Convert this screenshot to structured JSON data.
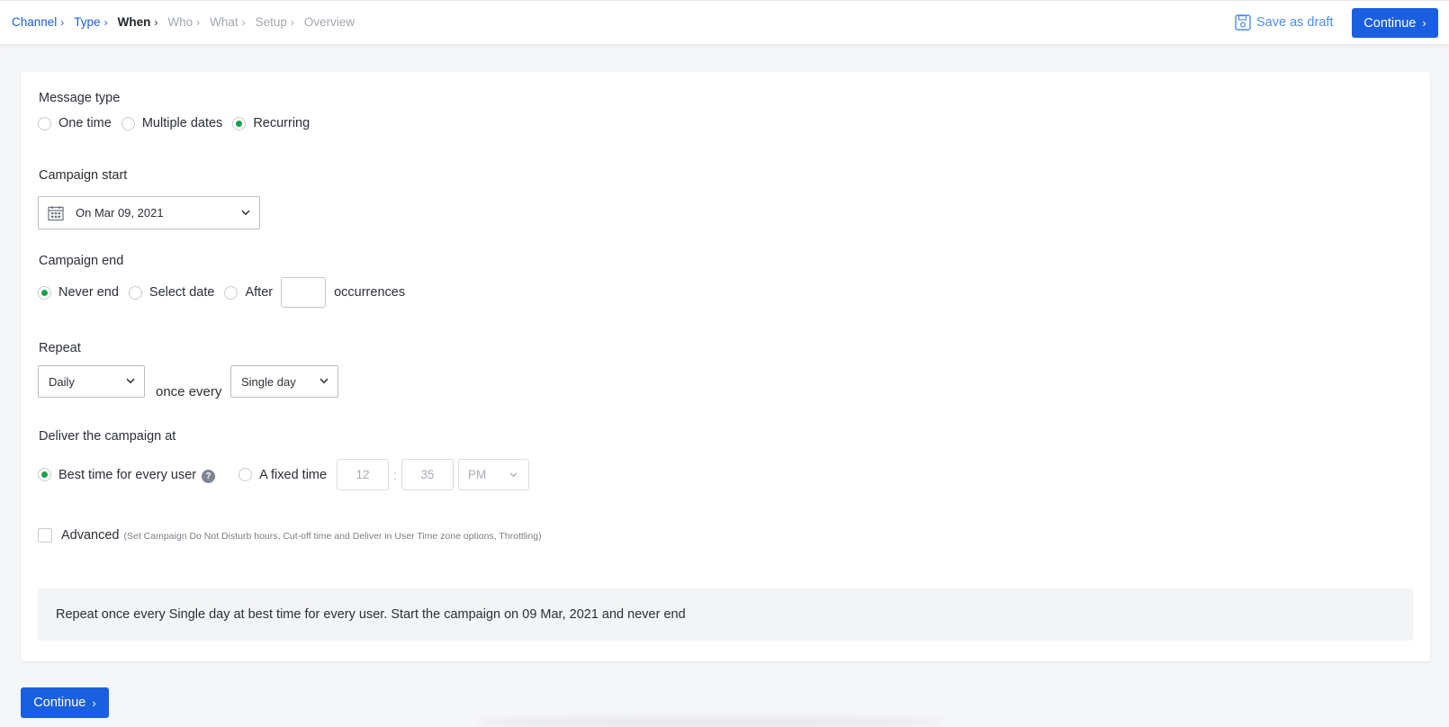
{
  "breadcrumb": [
    {
      "label": "Channel",
      "state": "done"
    },
    {
      "label": "Type",
      "state": "done"
    },
    {
      "label": "When",
      "state": "active"
    },
    {
      "label": "Who",
      "state": "todo"
    },
    {
      "label": "What",
      "state": "todo"
    },
    {
      "label": "Setup",
      "state": "todo"
    },
    {
      "label": "Overview",
      "state": "todo"
    }
  ],
  "header": {
    "save_draft_label": "Save as draft",
    "continue_label": "Continue"
  },
  "message_type": {
    "label": "Message type",
    "options": [
      "One time",
      "Multiple dates",
      "Recurring"
    ],
    "selected": "Recurring"
  },
  "campaign_start": {
    "label": "Campaign start",
    "value": "On Mar 09, 2021"
  },
  "campaign_end": {
    "label": "Campaign end",
    "options": [
      "Never end",
      "Select date",
      "After"
    ],
    "selected": "Never end",
    "occurrences_value": "",
    "occurrences_suffix": "occurrences"
  },
  "repeat": {
    "label": "Repeat",
    "frequency": "Daily",
    "connector": "once every",
    "interval": "Single day"
  },
  "deliver": {
    "label": "Deliver the campaign at",
    "options": [
      "Best time for every user",
      "A fixed time"
    ],
    "selected": "Best time for every user",
    "hour_placeholder": "12",
    "minute_placeholder": "35",
    "separator": ":",
    "ampm": "PM",
    "help_symbol": "?"
  },
  "advanced": {
    "label": "Advanced",
    "hint": "(Set Campaign Do Not Disturb hours, Cut-off time and Deliver in User Time zone options, Throttling)",
    "checked": false
  },
  "summary_text": "Repeat once every Single day at best time for every user. Start the campaign on 09 Mar, 2021 and never end",
  "footer": {
    "continue_label": "Continue"
  },
  "colors": {
    "primary": "#1a5fe0",
    "radio_selected": "#1aa349",
    "link": "#1d5fd6"
  }
}
